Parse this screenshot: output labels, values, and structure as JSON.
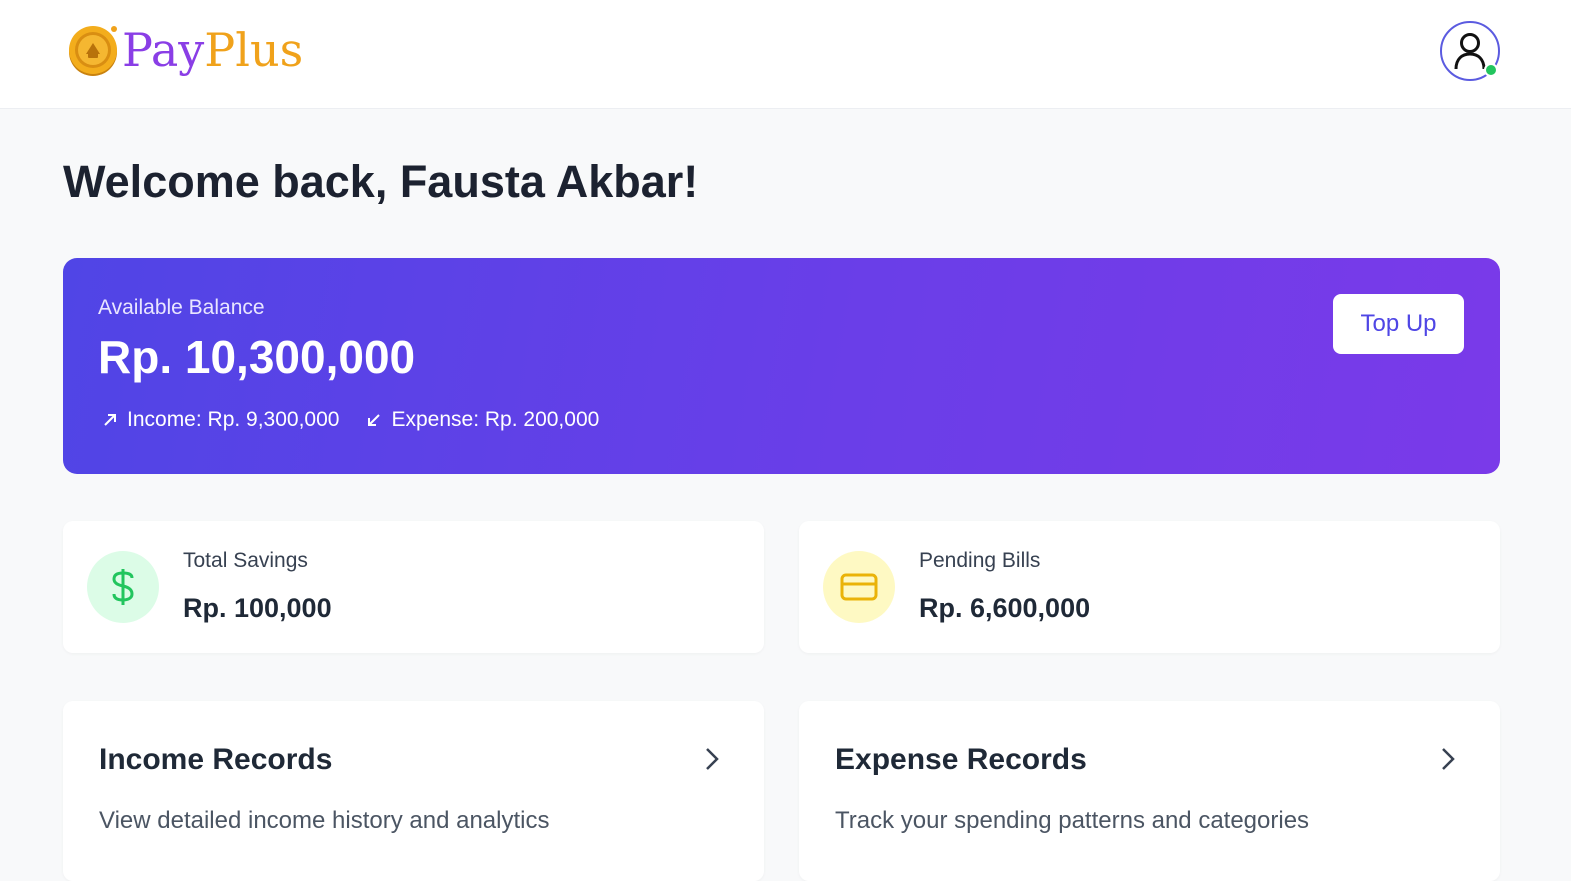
{
  "header": {
    "logo_part1": "Pay",
    "logo_part2": "Plus",
    "logo_icon": "coin-icon",
    "avatar_icon": "user-icon",
    "online_status_color": "#22c55e"
  },
  "welcome": {
    "text": "Welcome back, Fausta Akbar!"
  },
  "balance": {
    "label": "Available Balance",
    "amount": "Rp. 10,300,000",
    "income": "Income: Rp. 9,300,000",
    "expense": "Expense: Rp. 200,000",
    "topup_label": "Top Up",
    "income_icon": "arrow-up-right-icon",
    "expense_icon": "arrow-down-left-icon"
  },
  "stats": [
    {
      "label": "Total Savings",
      "value": "Rp. 100,000",
      "icon": "dollar-icon",
      "icon_color": "#22c55e",
      "icon_bg": "#dcfce7"
    },
    {
      "label": "Pending Bills",
      "value": "Rp. 6,600,000",
      "icon": "credit-card-icon",
      "icon_color": "#eab308",
      "icon_bg": "#fef9c3"
    }
  ],
  "records": [
    {
      "title": "Income Records",
      "description": "View detailed income history and analytics",
      "icon": "chevron-right-icon"
    },
    {
      "title": "Expense Records",
      "description": "Track your spending patterns and categories",
      "icon": "chevron-right-icon"
    }
  ],
  "colors": {
    "accent": "#4f46e5",
    "card_gradient_start": "#5045e6",
    "card_gradient_end": "#7a3ae9",
    "background": "#f8f9fa"
  }
}
